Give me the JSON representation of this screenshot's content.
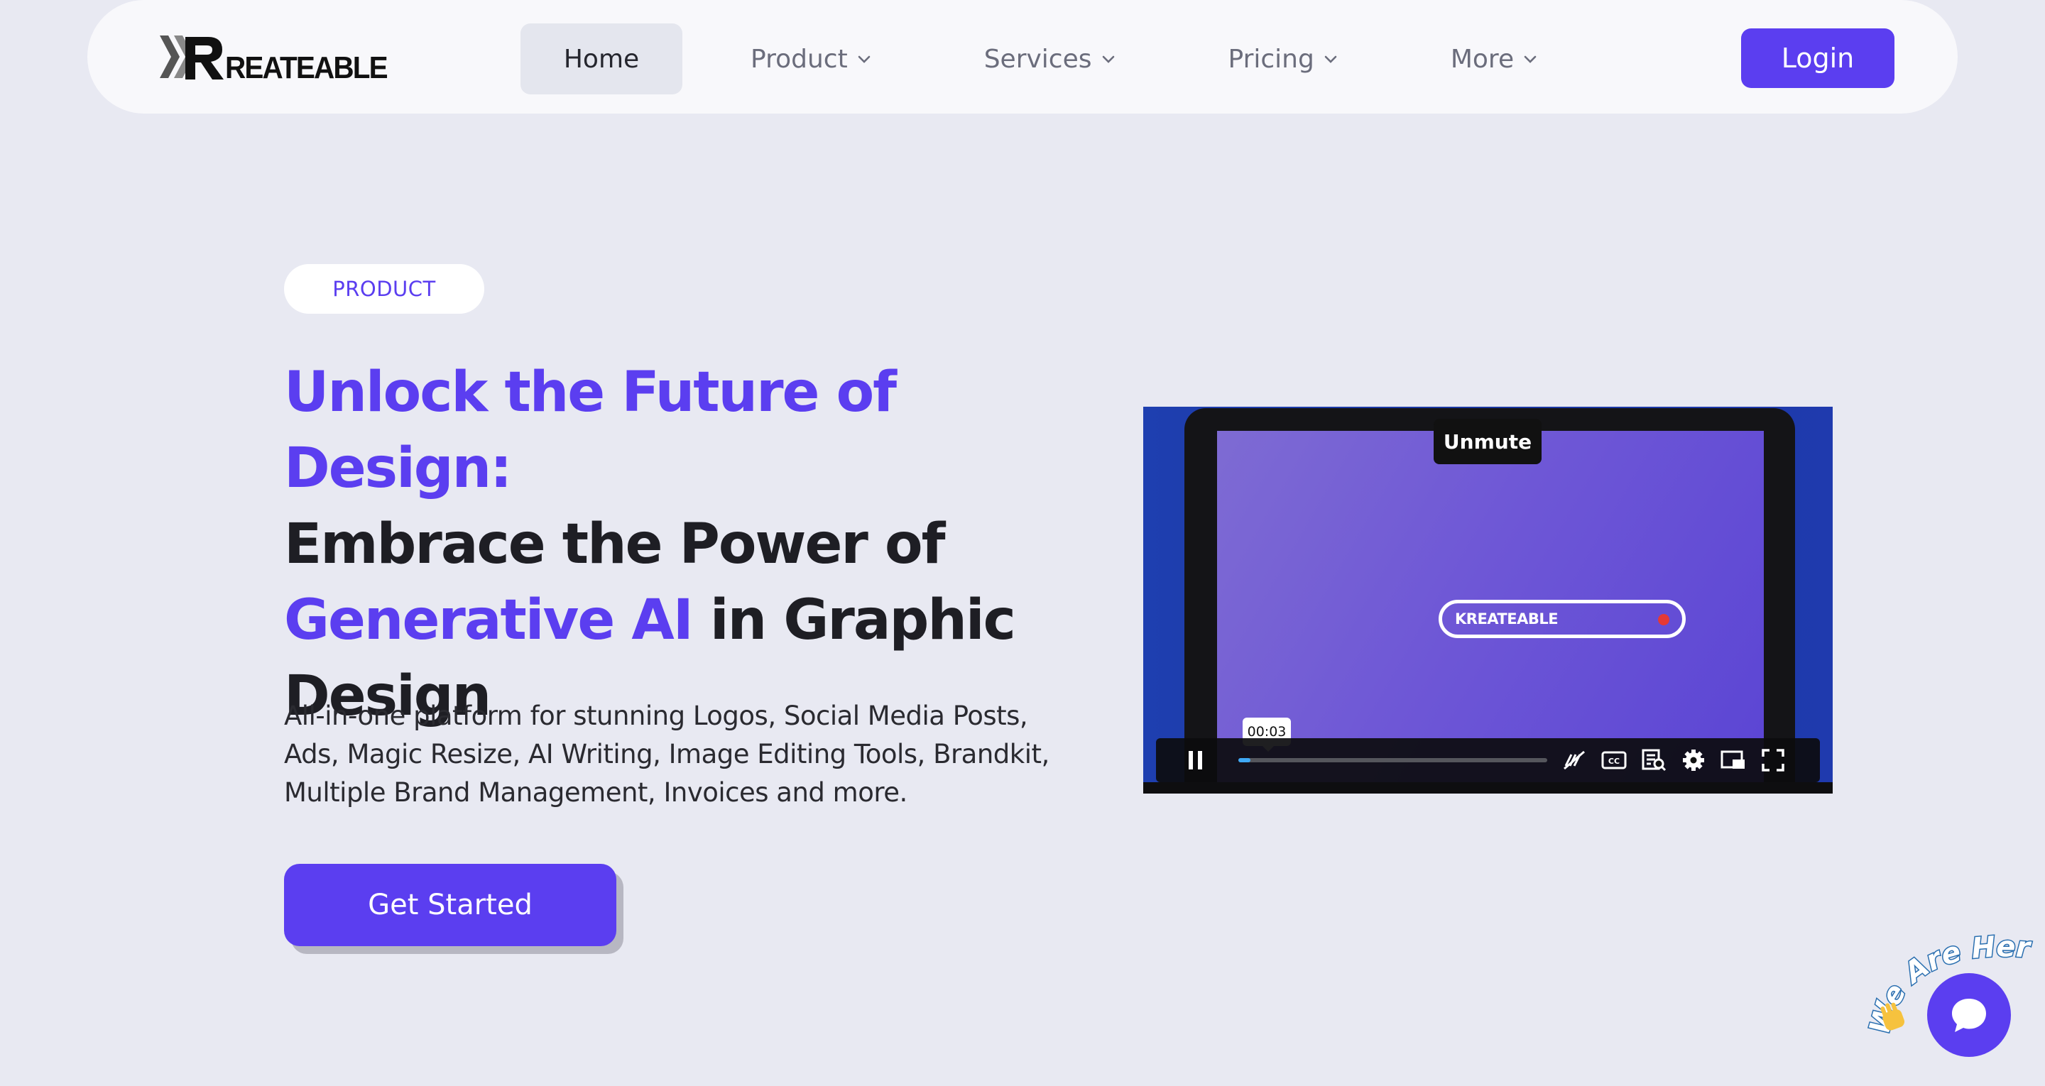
{
  "brand": {
    "name": "REATEABLE",
    "accent": "#5B3EF0"
  },
  "nav": {
    "items": [
      {
        "label": "Home",
        "active": true
      },
      {
        "label": "Product",
        "dropdown": true
      },
      {
        "label": "Services",
        "dropdown": true
      },
      {
        "label": "Pricing",
        "dropdown": true
      },
      {
        "label": "More",
        "dropdown": true
      }
    ],
    "login_label": "Login"
  },
  "hero": {
    "tag": "PRODUCT",
    "headline": {
      "part1": "Unlock the Future of Design:",
      "part2": "Embrace the Power of",
      "part3": "Generative AI",
      "part4": " in Graphic",
      "part5": "Design"
    },
    "description": "All-in-one platform for stunning Logos, Social Media Posts, Ads, Magic Resize, AI Writing, Image Editing Tools, Brandkit, Multiple Brand Management, Invoices and more.",
    "cta_label": "Get Started"
  },
  "video": {
    "unmute_label": "Unmute",
    "screen_text": "KREATEABLE",
    "current_time": "00:03",
    "progress": 0.04,
    "controls": [
      "pause-icon",
      "captions-off-icon",
      "cc-icon",
      "transcript-icon",
      "settings-icon",
      "pip-icon",
      "fullscreen-icon"
    ]
  },
  "chat": {
    "badge_text": "We Are Here!",
    "icon": "chat-bubble-icon"
  }
}
